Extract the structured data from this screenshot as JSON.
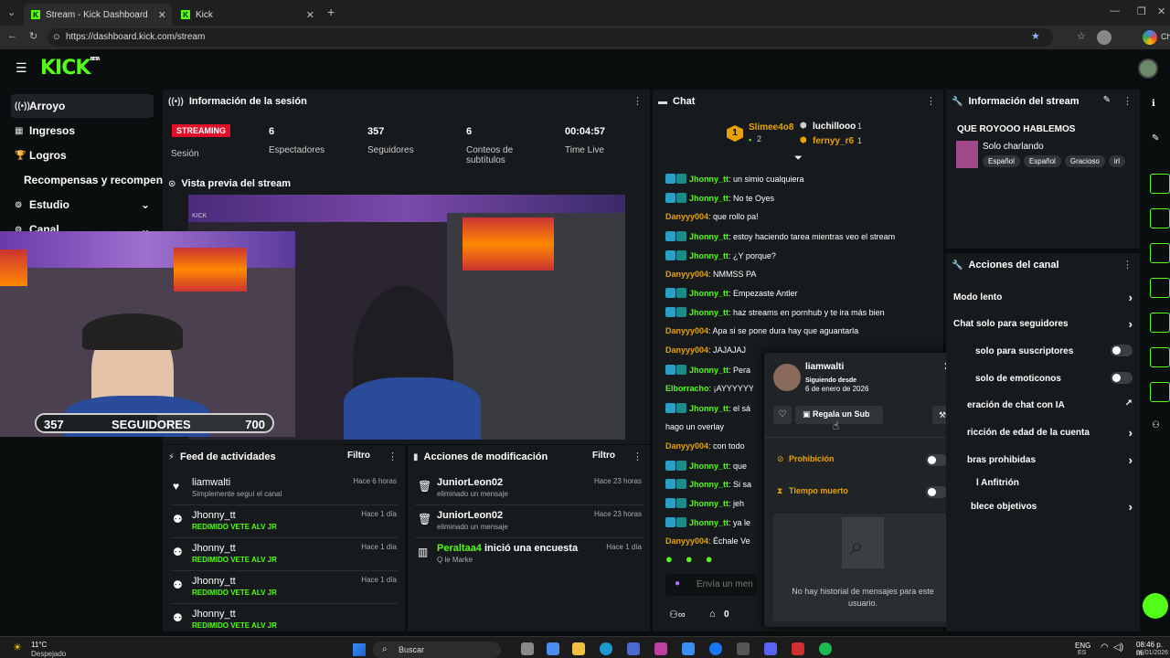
{
  "browser": {
    "tabs": [
      {
        "title": "Stream - Kick Dashboard"
      },
      {
        "title": "Kick"
      }
    ],
    "url": "https://dashboard.kick.com/stream",
    "profile_label": "Ch"
  },
  "app": {
    "logo": "KICK",
    "logo_tag": "BETA"
  },
  "sidebar": {
    "items": [
      {
        "label": "Arroyo"
      },
      {
        "label": "Ingresos"
      },
      {
        "label": "Logros"
      },
      {
        "label": "Recompensas y recompensas"
      },
      {
        "label": "Estudio"
      },
      {
        "label": "Canal"
      }
    ]
  },
  "session": {
    "title": "Información de la sesión",
    "status": "STREAMING",
    "status_label": "Sesión",
    "stats": [
      {
        "value": "6",
        "label": "Espectadores"
      },
      {
        "value": "357",
        "label": "Seguidores"
      },
      {
        "value": "6",
        "label": "Conteos de subtítulos"
      },
      {
        "value": "00:04:57",
        "label": "Time Live"
      }
    ]
  },
  "preview": {
    "title": "Vista previa del stream",
    "followers_current": "357",
    "followers_label": "SEGUIDORES",
    "followers_goal": "700",
    "followers_progress": 0.51
  },
  "activity": {
    "title": "Feed de actividades",
    "filter": "Filtro",
    "items": [
      {
        "name": "liamwalti",
        "sub": "Simplemente seguí el canal",
        "time": "Hace 6 horas",
        "green": false
      },
      {
        "name": "Jhonny_tt",
        "sub": "REDIMIDO VETE ALV JR",
        "time": "Hace 1 día",
        "green": true
      },
      {
        "name": "Jhonny_tt",
        "sub": "REDIMIDO VETE ALV JR",
        "time": "Hace 1 día",
        "green": true
      },
      {
        "name": "Jhonny_tt",
        "sub": "REDIMIDO VETE ALV JR",
        "time": "Hace 1 día",
        "green": true
      },
      {
        "name": "Jhonny_tt",
        "sub": "REDIMIDO VETE ALV JR",
        "time": "",
        "green": true
      }
    ]
  },
  "modactions": {
    "title": "Acciones de modificación",
    "filter": "Filtro",
    "items": [
      {
        "name": "JuniorLeon02",
        "sub": "eliminado un mensaje",
        "time": "Hace 23 horas"
      },
      {
        "name": "JuniorLeon02",
        "sub": "eliminado un mensaje",
        "time": "Hace 23 horas"
      },
      {
        "name": "Peraltaa4",
        "name_suffix": " inició una encuesta",
        "sub": "Q le Marke",
        "time": "Hace 1 día"
      }
    ]
  },
  "chat": {
    "title": "Chat",
    "top": [
      {
        "rank": "1",
        "name": "Slimee4o8",
        "count": "2"
      },
      {
        "name": "luchillooo",
        "count": "1"
      },
      {
        "name": "fernyy_r6",
        "count": "1"
      }
    ],
    "messages": [
      {
        "user": "Jhonny_tt",
        "text": ": un simio cualquiera",
        "color": "green",
        "badges": true
      },
      {
        "user": "Jhonny_tt",
        "text": ": No te Oyes",
        "color": "green",
        "badges": true
      },
      {
        "user": "Danyyy004",
        "text": ": que rollo pa!",
        "color": "orange",
        "badges": false
      },
      {
        "user": "Jhonny_tt",
        "text": ": estoy haciendo tarea mientras veo el stream",
        "color": "green",
        "badges": true
      },
      {
        "user": "Jhonny_tt",
        "text": ": ¿Y porque?",
        "color": "green",
        "badges": true
      },
      {
        "user": "Danyyy004",
        "text": ": NMMSS PA",
        "color": "orange",
        "badges": false
      },
      {
        "user": "Jhonny_tt",
        "text": ": Empezaste Antler",
        "color": "green",
        "badges": true
      },
      {
        "user": "Jhonny_tt",
        "text": ": haz streams en pornhub y te ira más bien",
        "color": "green",
        "badges": true
      },
      {
        "user": "Danyyy004",
        "text": ": Apa si se pone dura hay que aguantarla",
        "color": "orange",
        "badges": false
      },
      {
        "user": "Danyyy004",
        "text": ": JAJAJAJ",
        "color": "orange",
        "badges": false
      },
      {
        "user": "Jhonny_tt",
        "text": ": Pera",
        "color": "green",
        "badges": true
      },
      {
        "user": "Elborracho",
        "text": ": ¡AYYYYYY",
        "color": "green",
        "badges": false
      },
      {
        "user": "Jhonny_tt",
        "text": ": el sá",
        "color": "green",
        "badges": true
      },
      {
        "user": "",
        "text": "hago un overlay",
        "color": "none",
        "badges": false
      },
      {
        "user": "Danyyy004",
        "text": ": con todo",
        "color": "orange",
        "badges": false
      },
      {
        "user": "Jhonny_tt",
        "text": ": que",
        "color": "green",
        "badges": true
      },
      {
        "user": "Jhonny_tt",
        "text": ": Si sa",
        "color": "green",
        "badges": true
      },
      {
        "user": "Jhonny_tt",
        "text": ": jeh",
        "color": "green",
        "badges": true
      },
      {
        "user": "Jhonny_tt",
        "text": ": ya le",
        "color": "green",
        "badges": true
      },
      {
        "user": "Danyyy004",
        "text": ": Échale Ve",
        "color": "orange",
        "badges": false
      }
    ],
    "input_placeholder": "Envía un men",
    "footer_count": "0"
  },
  "popup": {
    "username": "liamwalti",
    "following_label": "Siguiendo desde",
    "following_date": "6 de enero de 2026",
    "gift_label": "Regala un Sub",
    "ban_label": "Prohibición",
    "timeout_label": "Tiempo muerto",
    "empty_history": "No hay historial de mensajes para este usuario."
  },
  "streaminfo": {
    "title": "Información del stream",
    "stream_title": "QUE ROYOOO HABLEMOS",
    "category": "Solo charlando",
    "tags": [
      "Español",
      "Español",
      "Gracioso",
      "irl"
    ]
  },
  "channelactions": {
    "title": "Acciones del canal",
    "items": [
      {
        "label": "Modo lento",
        "control": "arrow"
      },
      {
        "label": "Chat solo para seguidores",
        "control": "arrow"
      },
      {
        "label": "solo para suscriptores",
        "control": "toggle"
      },
      {
        "label": "solo de emoticonos",
        "control": "toggle"
      },
      {
        "label": "eración de chat con IA",
        "control": "external"
      },
      {
        "label": "ricción de edad de la cuenta",
        "control": "arrow"
      },
      {
        "label": "bras prohibidas",
        "control": "arrow"
      },
      {
        "label": "l Anfitrión",
        "control": "none"
      },
      {
        "label": "blece objetivos",
        "control": "arrow"
      }
    ]
  },
  "taskbar": {
    "weather_temp": "11°C",
    "weather_desc": "Despejado",
    "search_label": "Buscar",
    "lang_top": "ENG",
    "lang_bottom": "ES",
    "time": "08:46 p. m.",
    "date": "06/01/2026"
  }
}
